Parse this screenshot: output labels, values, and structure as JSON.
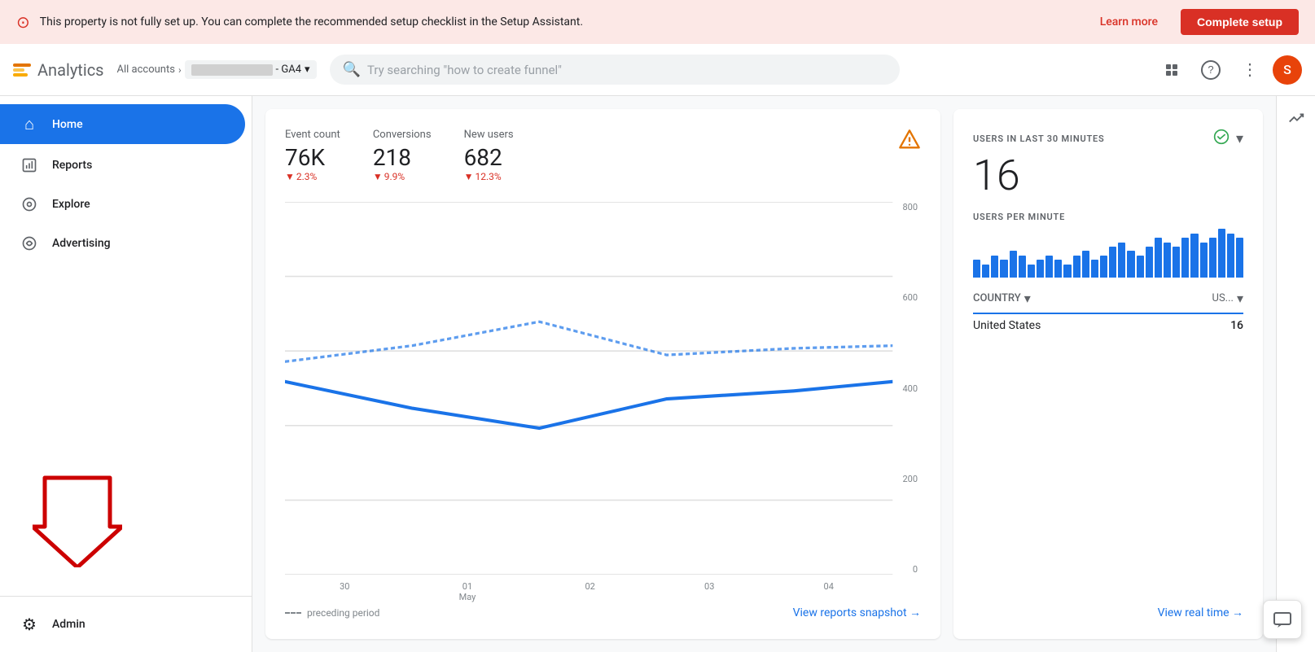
{
  "banner": {
    "text": "This property is not fully set up. You can complete the recommended setup checklist in the Setup Assistant.",
    "learn_more": "Learn more",
    "complete_btn": "Complete setup"
  },
  "header": {
    "app_name": "Analytics",
    "all_accounts": "All accounts",
    "property_suffix": "- GA4",
    "search_placeholder": "Try searching \"how to create funnel\"",
    "user_initial": "S"
  },
  "nav": {
    "items": [
      {
        "id": "home",
        "label": "Home",
        "active": true
      },
      {
        "id": "reports",
        "label": "Reports",
        "active": false
      },
      {
        "id": "explore",
        "label": "Explore",
        "active": false
      },
      {
        "id": "advertising",
        "label": "Advertising",
        "active": false
      }
    ],
    "admin_label": "Admin"
  },
  "metrics": [
    {
      "label": "Event count",
      "value": "76K",
      "change": "2.3%",
      "direction": "down"
    },
    {
      "label": "Conversions",
      "value": "218",
      "change": "9.9%",
      "direction": "down"
    },
    {
      "label": "New users",
      "value": "682",
      "change": "12.3%",
      "direction": "down"
    }
  ],
  "chart": {
    "y_labels": [
      "800",
      "600",
      "400",
      "200",
      "0"
    ],
    "x_labels": [
      "30",
      "01\nMay",
      "02",
      "03",
      "04"
    ],
    "preceding_period": "preceding period",
    "view_reports_link": "View reports snapshot →"
  },
  "realtime": {
    "title": "USERS IN LAST 30 MINUTES",
    "count": "16",
    "users_per_min_label": "USERS PER MINUTE",
    "country_label": "COUNTRY",
    "country_filter": "US...",
    "country_item": "United States",
    "country_count": "16",
    "view_link": "View real time →",
    "bar_data": [
      4,
      3,
      5,
      4,
      6,
      5,
      3,
      4,
      5,
      4,
      3,
      5,
      6,
      4,
      5,
      7,
      8,
      6,
      5,
      7,
      9,
      8,
      7,
      9,
      10,
      8,
      9,
      11,
      10,
      9
    ]
  }
}
